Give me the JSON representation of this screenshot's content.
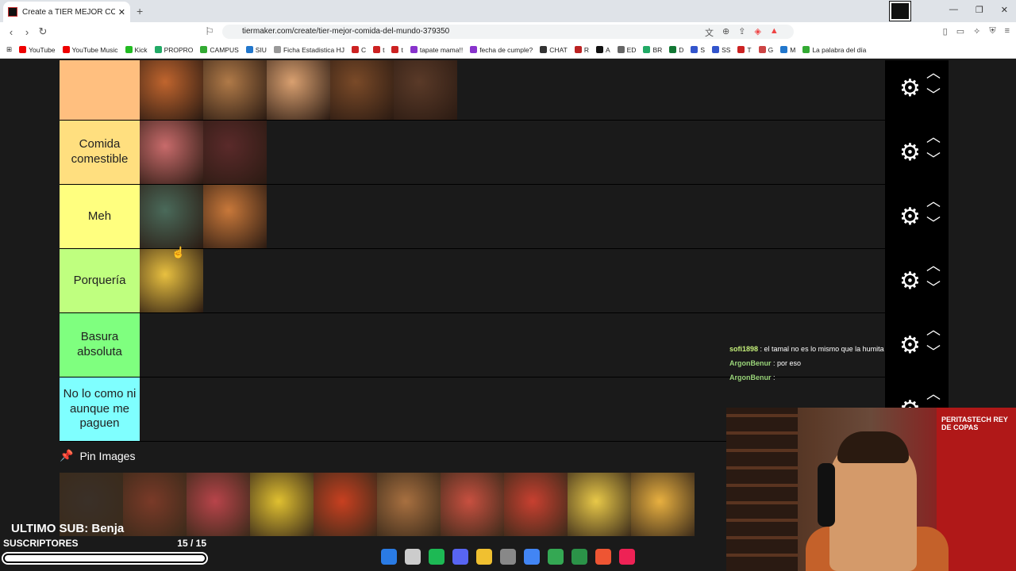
{
  "browser": {
    "tab_title": "Create a TIER MEJOR COMIDA DEL...",
    "tab_close": "✕",
    "new_tab": "+",
    "url": "tiermaker.com/create/tier-mejor-comida-del-mundo-379350",
    "window_controls": [
      "—",
      "❐",
      "✕"
    ],
    "bookmarks": [
      {
        "label": "YouTube",
        "color": "#e00"
      },
      {
        "label": "YouTube Music",
        "color": "#e00"
      },
      {
        "label": "Kick",
        "color": "#2b2"
      },
      {
        "label": "PROPRO",
        "color": "#2a6"
      },
      {
        "label": "CAMPUS",
        "color": "#3a3"
      },
      {
        "label": "SIU",
        "color": "#27c"
      },
      {
        "label": "Ficha Estadistica HJ",
        "color": "#999"
      },
      {
        "label": "C",
        "color": "#c22"
      },
      {
        "label": "t",
        "color": "#c22"
      },
      {
        "label": "t",
        "color": "#c22"
      },
      {
        "label": "tapate mama!!",
        "color": "#83c"
      },
      {
        "label": "fecha de cumple?",
        "color": "#83c"
      },
      {
        "label": "CHAT",
        "color": "#333"
      },
      {
        "label": "R",
        "color": "#b22"
      },
      {
        "label": "A",
        "color": "#111"
      },
      {
        "label": "ED",
        "color": "#666"
      },
      {
        "label": "BR",
        "color": "#2a6"
      },
      {
        "label": "D",
        "color": "#173"
      },
      {
        "label": "S",
        "color": "#35c"
      },
      {
        "label": "SS",
        "color": "#35c"
      },
      {
        "label": "T",
        "color": "#c22"
      },
      {
        "label": "G",
        "color": "#c44"
      },
      {
        "label": "M",
        "color": "#27c"
      },
      {
        "label": "La palabra del día",
        "color": "#3a3"
      }
    ]
  },
  "tiers": [
    {
      "label": "",
      "color": "#ffbf7f",
      "items": [
        "#c0652e",
        "#b07a48",
        "#d9a070",
        "#7a4a28",
        "#5a3a28"
      ]
    },
    {
      "label": "Comida comestible",
      "color": "#ffdf7f",
      "items": [
        "#c86b6b",
        "#5a2a2a"
      ]
    },
    {
      "label": "Meh",
      "color": "#ffff7f",
      "items": [
        "#4a6a5a",
        "#c8783a"
      ]
    },
    {
      "label": "Porquería",
      "color": "#bfff7f",
      "items": [
        "#e8c040"
      ]
    },
    {
      "label": "Basura absoluta",
      "color": "#7fff7f",
      "items": []
    },
    {
      "label": "No lo como ni aunque me paguen",
      "color": "#7fffff",
      "items": []
    }
  ],
  "pin": {
    "title": "Pin Images",
    "items": [
      "#3a3028",
      "#7a3a28",
      "#b8444a",
      "#e0c030",
      "#c84020",
      "#a87040",
      "#c85040",
      "#c84030",
      "#e8c848",
      "#e8b040"
    ]
  },
  "chat": [
    {
      "user": "sofi1898",
      "text": " : el tamal no es lo mismo que la humita",
      "style": "user1"
    },
    {
      "user": "ArgonBenur",
      "text": " : por eso",
      "style": "user2"
    },
    {
      "user": "ArgonBenur",
      "text": " : ",
      "style": "user2"
    }
  ],
  "stream": {
    "last_sub": "ULTIMO SUB: Benja",
    "subs_label": "SUSCRIPTORES",
    "subs_count": "15  / 15",
    "subs_progress": 1.0,
    "banner_text": "PERITASTECH REY DE COPAS"
  },
  "taskbar_colors": [
    "#2a7be4",
    "#ccc",
    "#1db954",
    "#5865f2",
    "#f0c030",
    "#888",
    "#4285f4",
    "#34a853",
    "#2b9348",
    "#ee5533",
    "#ee2255"
  ]
}
